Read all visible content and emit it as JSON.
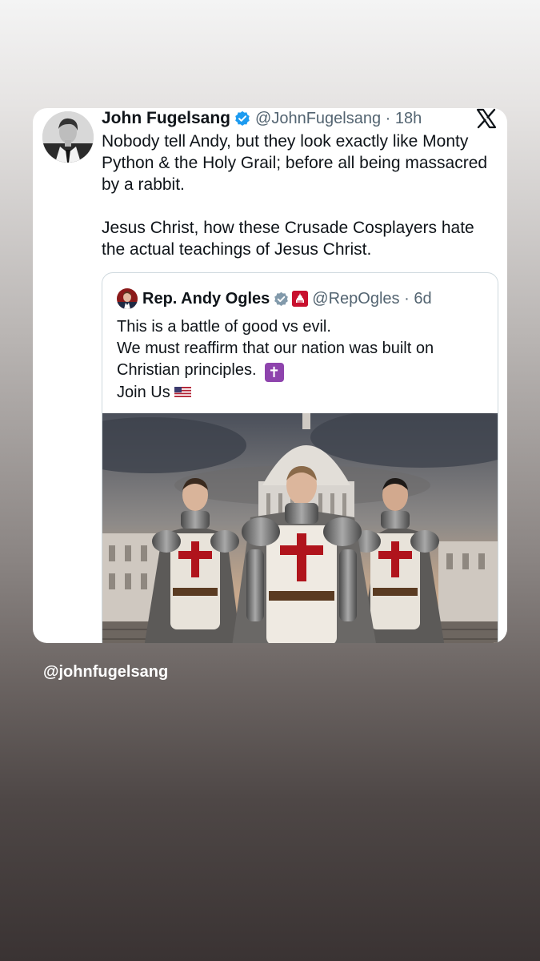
{
  "post": {
    "author_name": "John Fugelsang",
    "author_handle": "@JohnFugelsang",
    "time": "18h",
    "paragraph1": "Nobody tell Andy, but they look exactly like Monty Python & the Holy Grail; before all being massacred by a rabbit.",
    "paragraph2": "Jesus Christ, how these Crusade Cosplayers hate the actual teachings of Jesus Christ.",
    "platform_icon": "x-logo-icon",
    "verified_icon": "blue-check-icon"
  },
  "quote": {
    "author_name": "Rep. Andy Ogles",
    "author_handle": "@RepOgles",
    "time": "6d",
    "line1": "This is a battle of good vs evil.",
    "line2": "We must reaffirm that our nation was built on",
    "line3": "Christian principles.",
    "line4": "Join Us",
    "badge_icons": [
      "grey-check-icon",
      "government-flag-badge-icon"
    ],
    "emoji": [
      "latin-cross-emoji",
      "us-flag-emoji"
    ],
    "image": "three-knights-templar-in-front-of-capitol-image"
  },
  "story": {
    "mention": "@johnfugelsang"
  },
  "colors": {
    "verified_blue": "#1d9bf0",
    "handle_grey": "#536471",
    "cross_purple": "#8e44ad",
    "templar_red": "#b0141c"
  }
}
